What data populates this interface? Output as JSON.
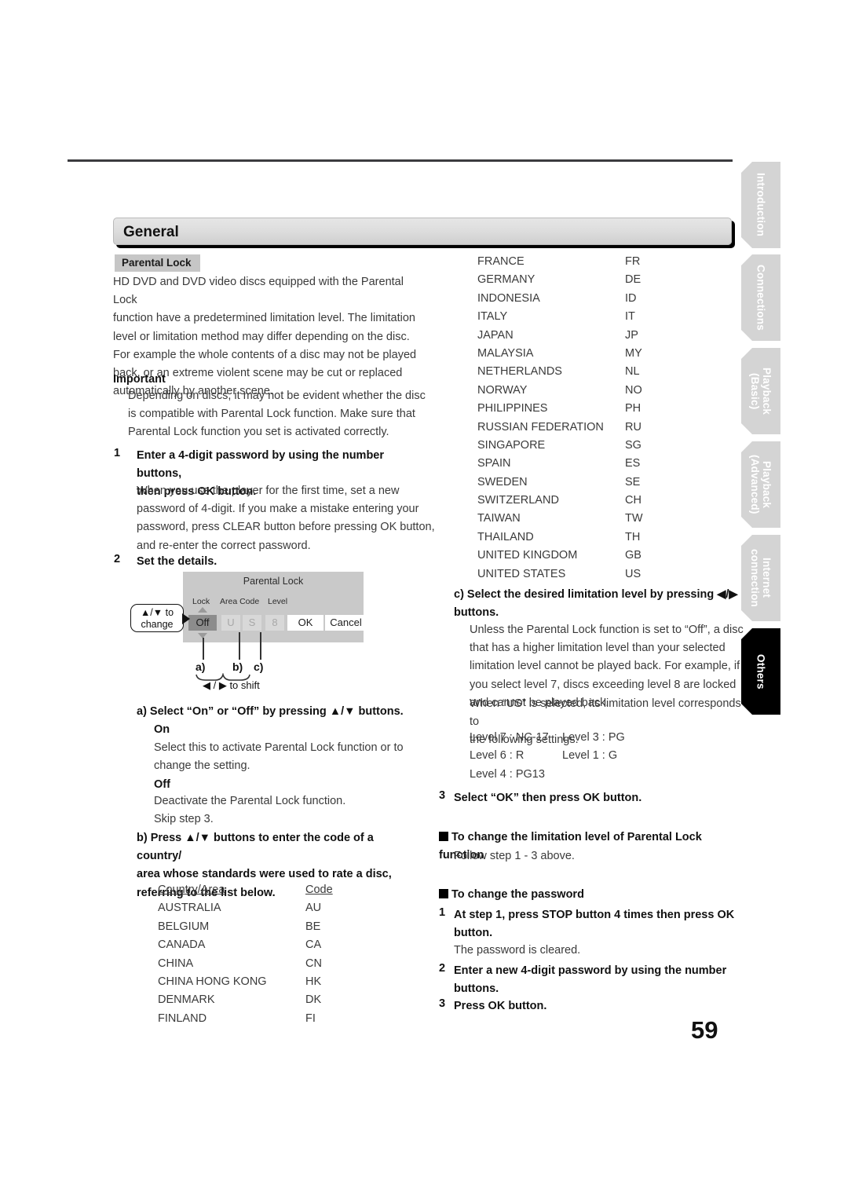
{
  "page": {
    "number": "59"
  },
  "section": {
    "title": "General",
    "badge": "Parental Lock"
  },
  "side_tabs": [
    {
      "label": "Introduction",
      "active": false
    },
    {
      "label": "Connections",
      "active": false
    },
    {
      "label": "Playback\n(Basic)",
      "active": false
    },
    {
      "label": "Playback\n(Advanced)",
      "active": false
    },
    {
      "label": "Internet\nconnection",
      "active": false
    },
    {
      "label": "Others",
      "active": true
    }
  ],
  "left": {
    "intro": "HD DVD and DVD video discs equipped with the Parental Lock\nfunction have a predetermined limitation level. The limitation\nlevel or limitation method may differ depending on the disc.\nFor example the whole contents of a disc may not be played\nback, or an extreme violent scene may be cut or replaced\nautomatically by another scene.",
    "important_head": "Important",
    "important_body": "Depending on discs, it may not be evident whether the disc\nis compatible with Parental Lock function. Make sure that\nParental Lock function you set is activated correctly.",
    "step1_num": "1",
    "step1_head": "Enter a 4-digit password by using the number buttons,\nthen press OK button.",
    "step1_body": "When you use the player for the first time, set a new\npassword of 4-digit. If you make a mistake entering your\npassword, press CLEAR button before pressing OK button,\nand re-enter the correct password.",
    "step2_num": "2",
    "step2_head": "Set the details.",
    "item_a_head": "a) Select “On” or “Off” by pressing ▲/▼ buttons.",
    "item_a_on_head": "On",
    "item_a_on_body": "Select this to activate Parental Lock function or to\nchange the setting.",
    "item_a_off_head": "Off",
    "item_a_off_body": "Deactivate the Parental Lock function.\nSkip step 3.",
    "item_b_head": "b) Press ▲/▼ buttons to enter the code of a country/\narea whose standards were used to rate a disc,\nreferring to the list below."
  },
  "osd": {
    "title": "Parental Lock",
    "col_lock": "Lock",
    "col_area": "Area Code",
    "col_level": "Level",
    "value_lock": "Off",
    "value_area_1": "U",
    "value_area_2": "S",
    "value_level": "8",
    "btn_ok": "OK",
    "btn_cancel": "Cancel",
    "callout": "▲/▼ to\nchange",
    "letter_a": "a)",
    "letter_b": "b)",
    "letter_c": "c)",
    "shift_note": "◀ / ▶ to shift"
  },
  "country_table": {
    "header_name": "Country/Area",
    "header_code": "Code",
    "rows_left": [
      {
        "name": "AUSTRALIA",
        "code": "AU"
      },
      {
        "name": "BELGIUM",
        "code": "BE"
      },
      {
        "name": "CANADA",
        "code": "CA"
      },
      {
        "name": "CHINA",
        "code": "CN"
      },
      {
        "name": "CHINA HONG KONG",
        "code": "HK"
      },
      {
        "name": "DENMARK",
        "code": "DK"
      },
      {
        "name": "FINLAND",
        "code": "FI"
      }
    ],
    "rows_right": [
      {
        "name": "FRANCE",
        "code": "FR"
      },
      {
        "name": "GERMANY",
        "code": "DE"
      },
      {
        "name": "INDONESIA",
        "code": "ID"
      },
      {
        "name": "ITALY",
        "code": "IT"
      },
      {
        "name": "JAPAN",
        "code": "JP"
      },
      {
        "name": "MALAYSIA",
        "code": "MY"
      },
      {
        "name": "NETHERLANDS",
        "code": "NL"
      },
      {
        "name": "NORWAY",
        "code": "NO"
      },
      {
        "name": "PHILIPPINES",
        "code": "PH"
      },
      {
        "name": "RUSSIAN FEDERATION",
        "code": "RU"
      },
      {
        "name": "SINGAPORE",
        "code": "SG"
      },
      {
        "name": "SPAIN",
        "code": "ES"
      },
      {
        "name": "SWEDEN",
        "code": "SE"
      },
      {
        "name": "SWITZERLAND",
        "code": "CH"
      },
      {
        "name": "TAIWAN",
        "code": "TW"
      },
      {
        "name": "THAILAND",
        "code": "TH"
      },
      {
        "name": "UNITED KINGDOM",
        "code": "GB"
      },
      {
        "name": "UNITED STATES",
        "code": "US"
      }
    ]
  },
  "right": {
    "item_c_head": "c) Select the desired limitation level by pressing ◀/▶\nbuttons.",
    "item_c_body1": "Unless the Parental Lock function is set to “Off”, a disc\nthat has a higher limitation level than your selected\nlimitation level cannot be played back. For example, if\nyou select level 7, discs exceeding level 8 are locked\nand cannot be played back.",
    "item_c_body2": "When “US” is selected, its limitation level corresponds to\nthe following settings.",
    "levels": [
      {
        "a": "Level 7 : NC-17",
        "b": "Level 3 : PG"
      },
      {
        "a": "Level 6 : R",
        "b": "Level 1 : G"
      },
      {
        "a": "Level 4 : PG13",
        "b": ""
      }
    ],
    "step3_num": "3",
    "step3_head": "Select “OK” then press OK button.",
    "change_level_head": "To change the limitation level of Parental Lock function",
    "change_level_body": "Follow step 1 - 3 above.",
    "change_pw_head": "To change the password",
    "pw_step1_num": "1",
    "pw_step1_head": "At step 1, press STOP button 4 times then press OK\nbutton.",
    "pw_step1_body": "The password is cleared.",
    "pw_step2_num": "2",
    "pw_step2_head": "Enter a new 4-digit password by using the number\nbuttons.",
    "pw_step3_num": "3",
    "pw_step3_head": "Press OK button."
  }
}
